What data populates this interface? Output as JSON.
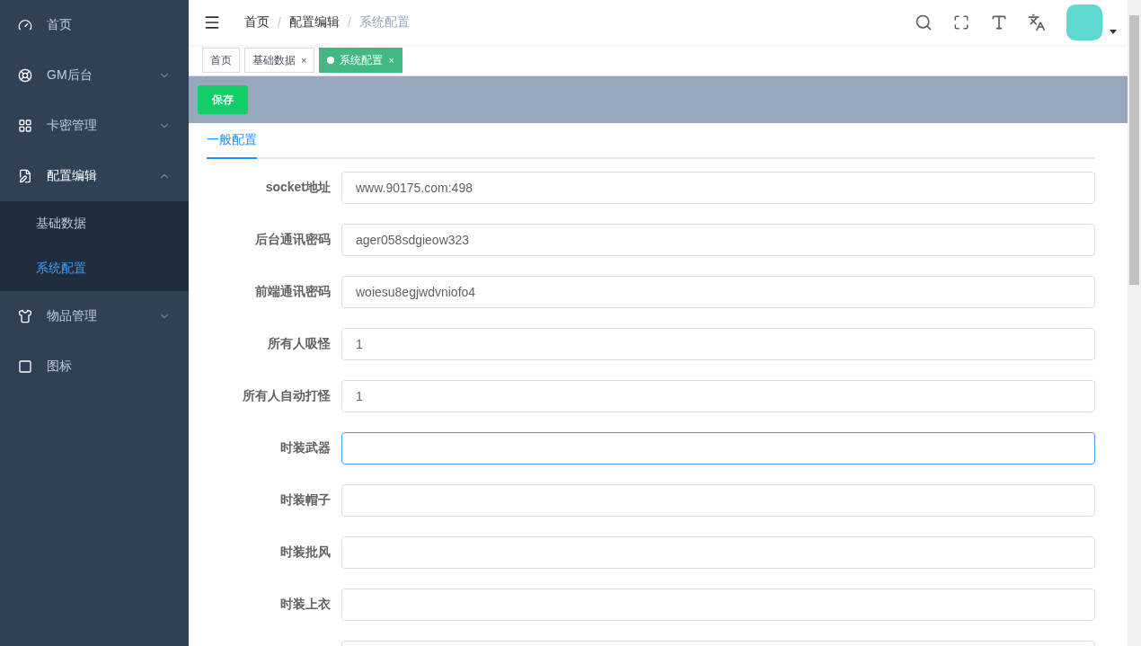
{
  "sidebar": {
    "items": [
      {
        "label": "首页"
      },
      {
        "label": "GM后台",
        "expanded": false
      },
      {
        "label": "卡密管理",
        "expanded": false
      },
      {
        "label": "配置编辑",
        "expanded": true,
        "children": [
          {
            "label": "基础数据",
            "selected": false
          },
          {
            "label": "系统配置",
            "selected": true
          }
        ]
      },
      {
        "label": "物品管理",
        "expanded": false
      },
      {
        "label": "图标"
      }
    ]
  },
  "header": {
    "breadcrumb": [
      {
        "label": "首页",
        "current": false
      },
      {
        "label": "配置编辑",
        "current": false
      },
      {
        "label": "系统配置",
        "current": true
      }
    ],
    "separator": "/"
  },
  "tags": [
    {
      "label": "首页",
      "selected": false,
      "closable": false
    },
    {
      "label": "基础数据",
      "selected": false,
      "closable": true
    },
    {
      "label": "系统配置",
      "selected": true,
      "closable": true
    }
  ],
  "close_glyph": "×",
  "toolbar": {
    "save_button": "保存"
  },
  "tabs": [
    {
      "label": "一般配置",
      "selected": true
    }
  ],
  "form": [
    {
      "label": "socket地址",
      "value": "www.90175.com:498",
      "focused": false
    },
    {
      "label": "后台通讯密码",
      "value": "ager058sdgieow323",
      "focused": false
    },
    {
      "label": "前端通讯密码",
      "value": "woiesu8egjwdvniofo4",
      "focused": false
    },
    {
      "label": "所有人吸怪",
      "value": "1",
      "focused": false
    },
    {
      "label": "所有人自动打怪",
      "value": "1",
      "focused": false
    },
    {
      "label": "时装武器",
      "focused": true
    },
    {
      "label": "时装帽子",
      "focused": false
    },
    {
      "label": "时装批风",
      "focused": false
    },
    {
      "label": "时装上衣",
      "focused": false
    },
    {
      "focused": false
    }
  ]
}
